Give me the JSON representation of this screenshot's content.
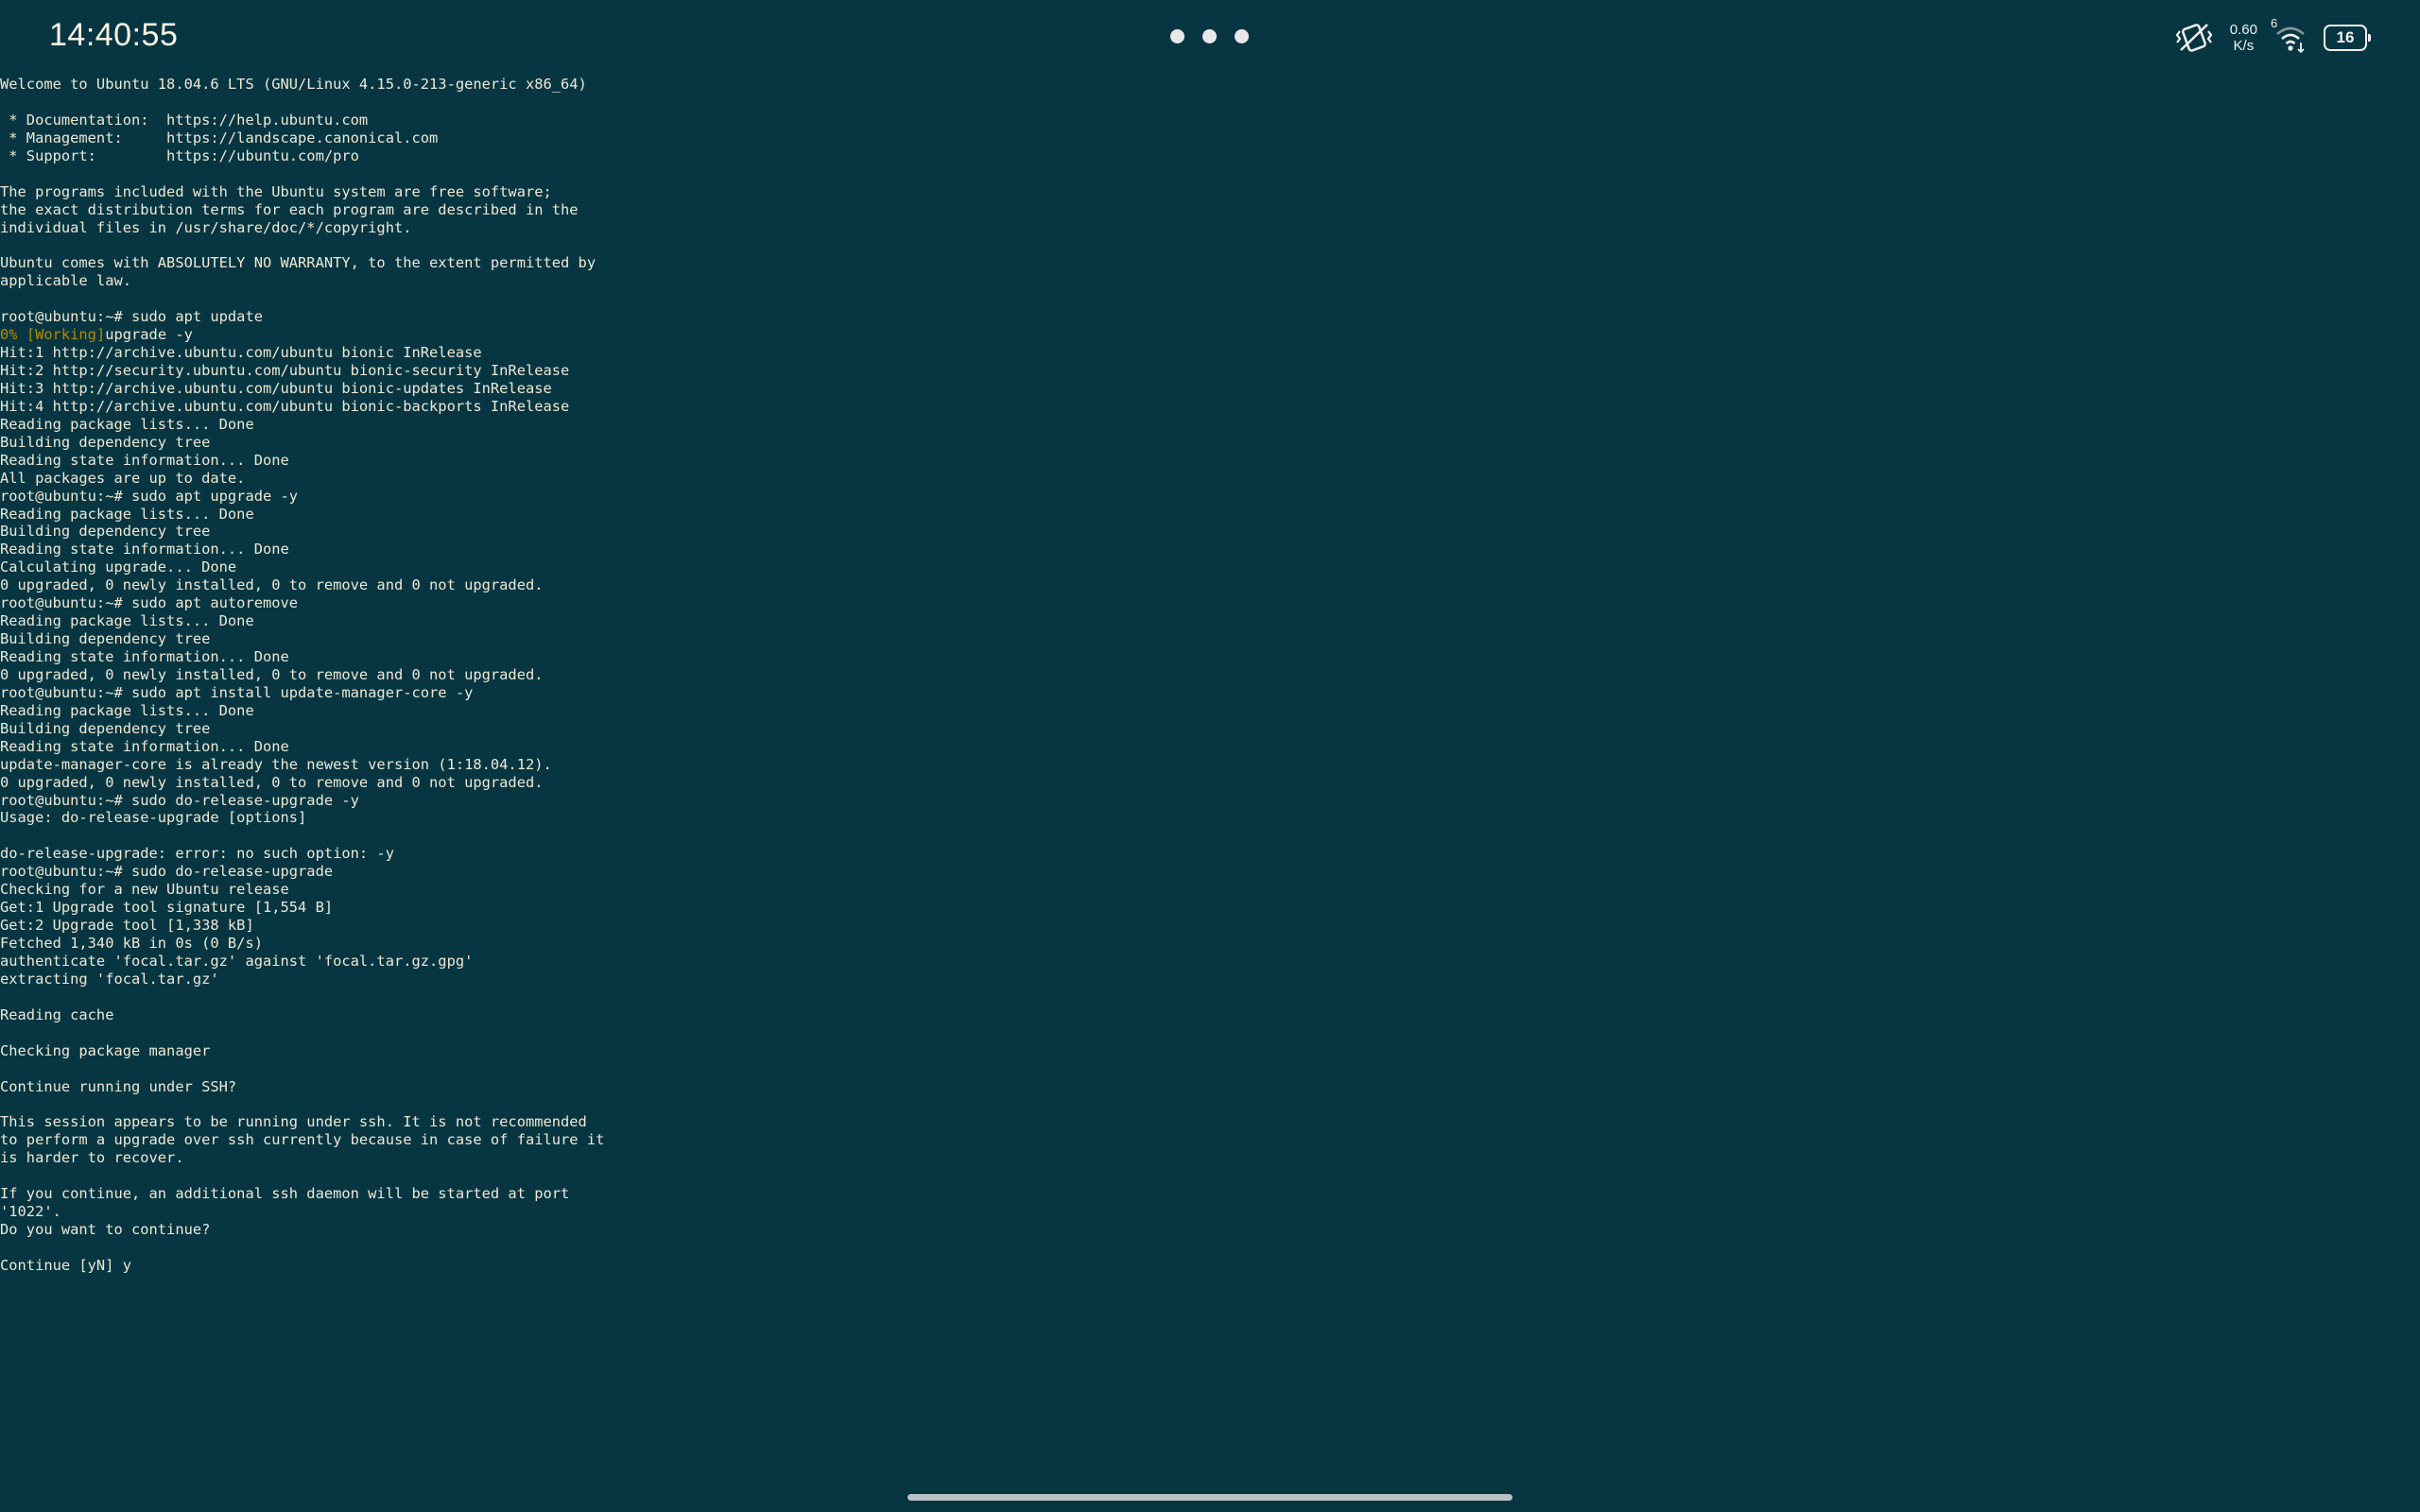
{
  "status_bar": {
    "clock": "14:40:55",
    "net_speed_value": "0.60",
    "net_speed_unit": "K/s",
    "wifi_badge": "6",
    "battery_level": "16",
    "icons": [
      "vibrate-off-icon",
      "wifi-icon",
      "battery-icon"
    ]
  },
  "terminal": {
    "lines": [
      "Welcome to Ubuntu 18.04.6 LTS (GNU/Linux 4.15.0-213-generic x86_64)",
      "",
      " * Documentation:  https://help.ubuntu.com",
      " * Management:     https://landscape.canonical.com",
      " * Support:        https://ubuntu.com/pro",
      "",
      "The programs included with the Ubuntu system are free software;",
      "the exact distribution terms for each program are described in the",
      "individual files in /usr/share/doc/*/copyright.",
      "",
      "Ubuntu comes with ABSOLUTELY NO WARRANTY, to the extent permitted by",
      "applicable law.",
      "",
      "root@ubuntu:~# sudo apt update",
      "",
      "Hit:1 http://archive.ubuntu.com/ubuntu bionic InRelease",
      "Hit:2 http://security.ubuntu.com/ubuntu bionic-security InRelease",
      "Hit:3 http://archive.ubuntu.com/ubuntu bionic-updates InRelease",
      "Hit:4 http://archive.ubuntu.com/ubuntu bionic-backports InRelease",
      "Reading package lists... Done",
      "Building dependency tree",
      "Reading state information... Done",
      "All packages are up to date.",
      "root@ubuntu:~# sudo apt upgrade -y",
      "Reading package lists... Done",
      "Building dependency tree",
      "Reading state information... Done",
      "Calculating upgrade... Done",
      "0 upgraded, 0 newly installed, 0 to remove and 0 not upgraded.",
      "root@ubuntu:~# sudo apt autoremove",
      "Reading package lists... Done",
      "Building dependency tree",
      "Reading state information... Done",
      "0 upgraded, 0 newly installed, 0 to remove and 0 not upgraded.",
      "root@ubuntu:~# sudo apt install update-manager-core -y",
      "Reading package lists... Done",
      "Building dependency tree",
      "Reading state information... Done",
      "update-manager-core is already the newest version (1:18.04.12).",
      "0 upgraded, 0 newly installed, 0 to remove and 0 not upgraded.",
      "root@ubuntu:~# sudo do-release-upgrade -y",
      "Usage: do-release-upgrade [options]",
      "",
      "do-release-upgrade: error: no such option: -y",
      "root@ubuntu:~# sudo do-release-upgrade",
      "Checking for a new Ubuntu release",
      "Get:1 Upgrade tool signature [1,554 B]",
      "Get:2 Upgrade tool [1,338 kB]",
      "Fetched 1,340 kB in 0s (0 B/s)",
      "authenticate 'focal.tar.gz' against 'focal.tar.gz.gpg'",
      "extracting 'focal.tar.gz'",
      "",
      "Reading cache",
      "",
      "Checking package manager",
      "",
      "Continue running under SSH?",
      "",
      "This session appears to be running under ssh. It is not recommended",
      "to perform a upgrade over ssh currently because in case of failure it",
      "is harder to recover.",
      "",
      "If you continue, an additional ssh daemon will be started at port",
      "'1022'.",
      "Do you want to continue?",
      "",
      "Continue [yN] y"
    ],
    "progress_line": {
      "index": 14,
      "percent": "0%",
      "tag": "[Working]",
      "rest": "upgrade -y"
    },
    "cursor_line": 67,
    "colors": {
      "background": "#073642",
      "foreground": "#eee8d5",
      "progress": "#b58900"
    }
  }
}
